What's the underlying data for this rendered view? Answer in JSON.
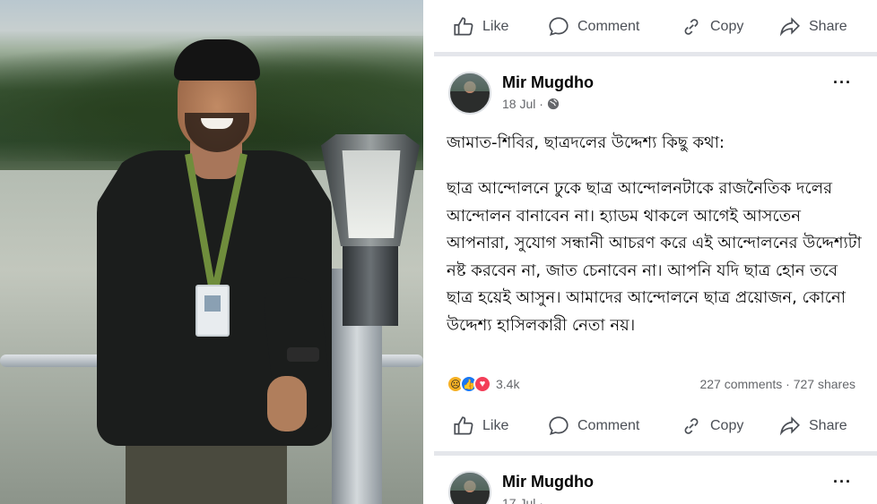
{
  "feed": {
    "actions": [
      {
        "label": "Like",
        "icon": "like-icon"
      },
      {
        "label": "Comment",
        "icon": "comment-icon"
      },
      {
        "label": "Copy",
        "icon": "copy-icon"
      },
      {
        "label": "Share",
        "icon": "share-icon"
      }
    ],
    "post": {
      "author": "Mir Mugdho",
      "date": "18 Jul ·",
      "privacy_icon": "globe-icon",
      "more": "···",
      "title": "জামাত-শিবির, ছাত্রদলের উদ্দেশ্য কিছু কথা:",
      "body": "ছাত্র আন্দোলনে ঢুকে ছাত্র আন্দোলনটাকে রাজনৈতিক দলের আন্দোলন বানাবেন না। হ্যাডম থাকলে আগেই আসতেন আপনারা, সুযোগ সন্ধানী আচরণ করে এই আন্দোলনের উদ্দেশ্যটা নষ্ট করবেন না, জাত চেনাবেন না। আপনি যদি ছাত্র হোন তবে ছাত্র হয়েই আসুন। আমাদের আন্দোলনে ছাত্র প্রয়োজন, কোনো উদ্দেশ্য হাসিলকারী নেতা নয়।",
      "reaction_count": "3.4k",
      "engagement": "227 comments · 727 shares"
    },
    "next_post": {
      "author": "Mir Mugdho",
      "date": "17 Jul ·",
      "more": "···"
    }
  },
  "colors": {
    "text_primary": "#050505",
    "text_secondary": "#65676b",
    "divider": "#e4e6eb",
    "like_blue": "#1877f2",
    "love_red": "#f33e58",
    "sad_yellow": "#f7b125"
  }
}
